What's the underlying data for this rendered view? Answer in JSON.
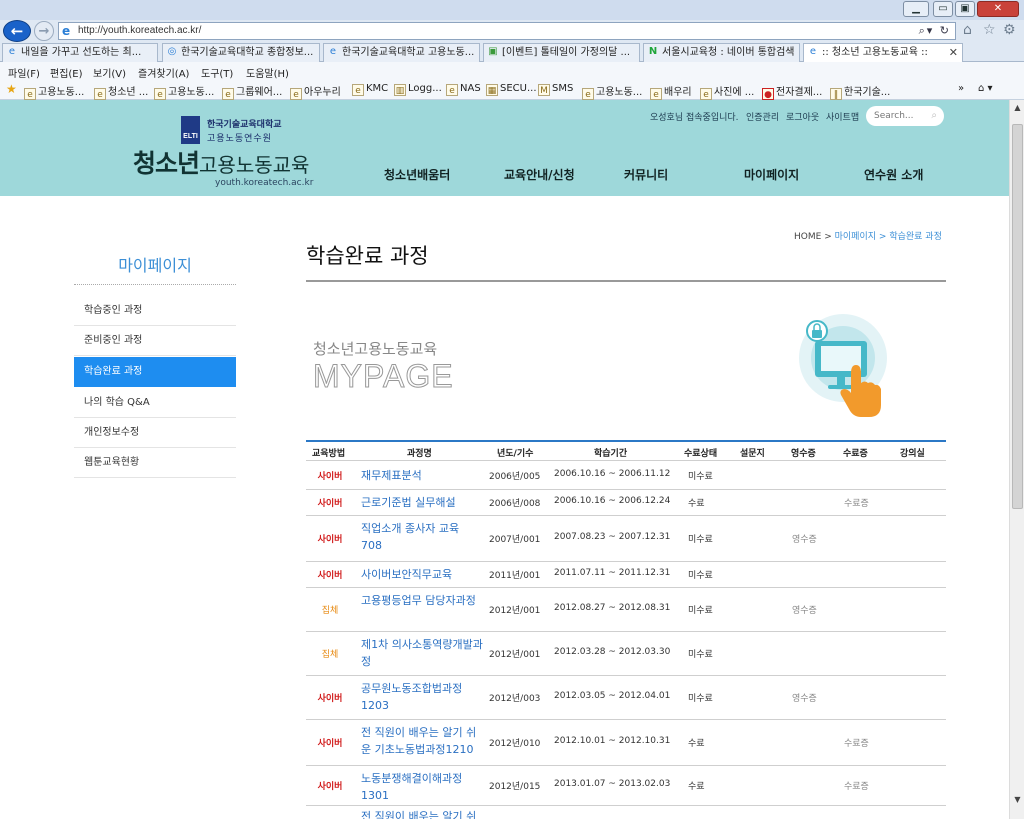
{
  "browser": {
    "address": "http://youth.koreatech.ac.kr/",
    "tabs": [
      "내일을 가꾸고 선도하는 최...",
      "한국기술교육대학교 종합정보...",
      "한국기술교육대학교 고용노동...",
      "[이벤트] 톨테일이 가정의달 ...",
      "서울시교육청 : 네이버 통합검색",
      ":: 청소년 고용노동교육 ::"
    ],
    "menu": [
      "파일(F)",
      "편집(E)",
      "보기(V)",
      "즐겨찾기(A)",
      "도구(T)",
      "도움말(H)"
    ],
    "favorites": [
      "고용노동...",
      "청소년 ...",
      "고용노동...",
      "그룹웨어...",
      "아우누리",
      "KMC",
      "Logg...",
      "NAS",
      "SECU...",
      "SMS",
      "고용노동...",
      "배우리",
      "사진에 ...",
      "전자결제...",
      "한국기술..."
    ]
  },
  "header": {
    "univ_name": "한국기술교육대학교",
    "inst_name": "고용노동연수원",
    "logo_main": "청소년",
    "logo_sub": "고용노동교육",
    "logo_url": "youth.koreatech.ac.kr",
    "logo_badge": "ELTI",
    "util": {
      "greeting": "오성호님 접속중입니다.",
      "cert": "인증관리",
      "logout": "로그아웃",
      "sitemap": "사이트맵"
    },
    "search_placeholder": "Search...",
    "nav": [
      "청소년배움터",
      "교육안내/신청",
      "커뮤니티",
      "마이페이지",
      "연수원 소개"
    ]
  },
  "sidebar": {
    "title": "마이페이지",
    "items": [
      "학습중인 과정",
      "준비중인 과정",
      "학습완료 과정",
      "나의 학습 Q&A",
      "개인정보수정",
      "웹툰교육현황"
    ]
  },
  "content": {
    "breadcrumb": {
      "home": "HOME",
      "sep1": ">",
      "mypage": "마이페이지",
      "sep2": ">",
      "current": "학습완료 과정"
    },
    "title": "학습완료 과정",
    "banner_kr": "청소년고용노동교육",
    "banner_en": "MYPAGE",
    "columns": [
      "교육방법",
      "과정명",
      "년도/기수",
      "학습기간",
      "수료상태",
      "설문지",
      "영수증",
      "수료증",
      "강의실"
    ],
    "rows": [
      {
        "method": "사이버",
        "course": "재무제표분석",
        "term": "2006년/005",
        "period": "2006.10.16 ~ 2006.11.12",
        "status": "미수료",
        "receipt": "",
        "cert": ""
      },
      {
        "method": "사이버",
        "course": "근로기준법 실무해설",
        "term": "2006년/008",
        "period": "2006.10.16 ~ 2006.12.24",
        "status": "수료",
        "receipt": "",
        "cert": "수료증"
      },
      {
        "method": "사이버",
        "course": "직업소개 종사자 교육 708",
        "term": "2007년/001",
        "period": "2007.08.23 ~ 2007.12.31",
        "status": "미수료",
        "receipt": "영수증",
        "cert": ""
      },
      {
        "method": "사이버",
        "course": "사이버보안직무교육",
        "term": "2011년/001",
        "period": "2011.07.11 ~ 2011.12.31",
        "status": "미수료",
        "receipt": "",
        "cert": ""
      },
      {
        "method": "집체",
        "course": "고용평등업무 담당자과정",
        "term": "2012년/001",
        "period": "2012.08.27 ~ 2012.08.31",
        "status": "미수료",
        "receipt": "영수증",
        "cert": ""
      },
      {
        "method": "집체",
        "course": "제1차 의사소통역량개발과정",
        "term": "2012년/001",
        "period": "2012.03.28 ~ 2012.03.30",
        "status": "미수료",
        "receipt": "",
        "cert": ""
      },
      {
        "method": "사이버",
        "course": "공무원노동조합법과정 1203",
        "term": "2012년/003",
        "period": "2012.03.05 ~ 2012.04.01",
        "status": "미수료",
        "receipt": "영수증",
        "cert": ""
      },
      {
        "method": "사이버",
        "course": "전 직원이 배우는 알기 쉬운 기초노동법과정1210",
        "term": "2012년/010",
        "period": "2012.10.01 ~ 2012.10.31",
        "status": "수료",
        "receipt": "",
        "cert": "수료증"
      },
      {
        "method": "사이버",
        "course": "노동분쟁해결이해과정 1301",
        "term": "2012년/015",
        "period": "2013.01.07 ~ 2013.02.03",
        "status": "수료",
        "receipt": "",
        "cert": "수료증"
      },
      {
        "method": "",
        "course": "전 직원이 배우는 알기 쉬",
        "term": "",
        "period": "",
        "status": "",
        "receipt": "",
        "cert": ""
      }
    ]
  }
}
